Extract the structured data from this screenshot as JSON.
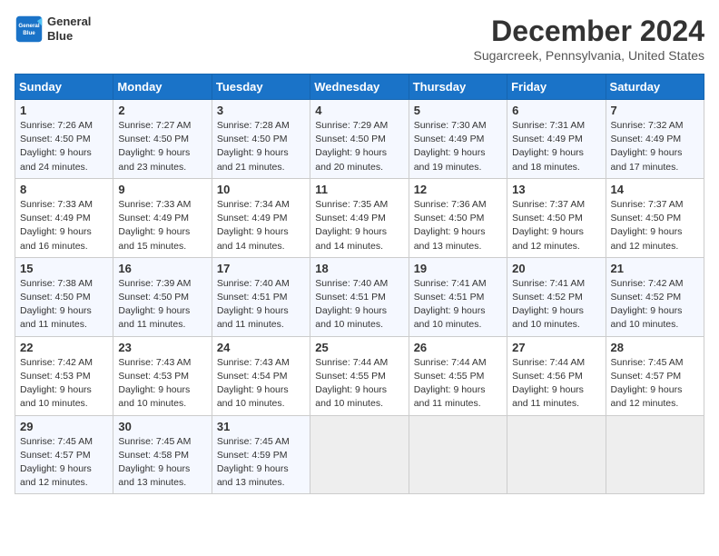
{
  "header": {
    "logo_line1": "General",
    "logo_line2": "Blue",
    "month": "December 2024",
    "location": "Sugarcreek, Pennsylvania, United States"
  },
  "days_of_week": [
    "Sunday",
    "Monday",
    "Tuesday",
    "Wednesday",
    "Thursday",
    "Friday",
    "Saturday"
  ],
  "weeks": [
    [
      {
        "day": "1",
        "info": "Sunrise: 7:26 AM\nSunset: 4:50 PM\nDaylight: 9 hours\nand 24 minutes."
      },
      {
        "day": "2",
        "info": "Sunrise: 7:27 AM\nSunset: 4:50 PM\nDaylight: 9 hours\nand 23 minutes."
      },
      {
        "day": "3",
        "info": "Sunrise: 7:28 AM\nSunset: 4:50 PM\nDaylight: 9 hours\nand 21 minutes."
      },
      {
        "day": "4",
        "info": "Sunrise: 7:29 AM\nSunset: 4:50 PM\nDaylight: 9 hours\nand 20 minutes."
      },
      {
        "day": "5",
        "info": "Sunrise: 7:30 AM\nSunset: 4:49 PM\nDaylight: 9 hours\nand 19 minutes."
      },
      {
        "day": "6",
        "info": "Sunrise: 7:31 AM\nSunset: 4:49 PM\nDaylight: 9 hours\nand 18 minutes."
      },
      {
        "day": "7",
        "info": "Sunrise: 7:32 AM\nSunset: 4:49 PM\nDaylight: 9 hours\nand 17 minutes."
      }
    ],
    [
      {
        "day": "8",
        "info": "Sunrise: 7:33 AM\nSunset: 4:49 PM\nDaylight: 9 hours\nand 16 minutes."
      },
      {
        "day": "9",
        "info": "Sunrise: 7:33 AM\nSunset: 4:49 PM\nDaylight: 9 hours\nand 15 minutes."
      },
      {
        "day": "10",
        "info": "Sunrise: 7:34 AM\nSunset: 4:49 PM\nDaylight: 9 hours\nand 14 minutes."
      },
      {
        "day": "11",
        "info": "Sunrise: 7:35 AM\nSunset: 4:49 PM\nDaylight: 9 hours\nand 14 minutes."
      },
      {
        "day": "12",
        "info": "Sunrise: 7:36 AM\nSunset: 4:50 PM\nDaylight: 9 hours\nand 13 minutes."
      },
      {
        "day": "13",
        "info": "Sunrise: 7:37 AM\nSunset: 4:50 PM\nDaylight: 9 hours\nand 12 minutes."
      },
      {
        "day": "14",
        "info": "Sunrise: 7:37 AM\nSunset: 4:50 PM\nDaylight: 9 hours\nand 12 minutes."
      }
    ],
    [
      {
        "day": "15",
        "info": "Sunrise: 7:38 AM\nSunset: 4:50 PM\nDaylight: 9 hours\nand 11 minutes."
      },
      {
        "day": "16",
        "info": "Sunrise: 7:39 AM\nSunset: 4:50 PM\nDaylight: 9 hours\nand 11 minutes."
      },
      {
        "day": "17",
        "info": "Sunrise: 7:40 AM\nSunset: 4:51 PM\nDaylight: 9 hours\nand 11 minutes."
      },
      {
        "day": "18",
        "info": "Sunrise: 7:40 AM\nSunset: 4:51 PM\nDaylight: 9 hours\nand 10 minutes."
      },
      {
        "day": "19",
        "info": "Sunrise: 7:41 AM\nSunset: 4:51 PM\nDaylight: 9 hours\nand 10 minutes."
      },
      {
        "day": "20",
        "info": "Sunrise: 7:41 AM\nSunset: 4:52 PM\nDaylight: 9 hours\nand 10 minutes."
      },
      {
        "day": "21",
        "info": "Sunrise: 7:42 AM\nSunset: 4:52 PM\nDaylight: 9 hours\nand 10 minutes."
      }
    ],
    [
      {
        "day": "22",
        "info": "Sunrise: 7:42 AM\nSunset: 4:53 PM\nDaylight: 9 hours\nand 10 minutes."
      },
      {
        "day": "23",
        "info": "Sunrise: 7:43 AM\nSunset: 4:53 PM\nDaylight: 9 hours\nand 10 minutes."
      },
      {
        "day": "24",
        "info": "Sunrise: 7:43 AM\nSunset: 4:54 PM\nDaylight: 9 hours\nand 10 minutes."
      },
      {
        "day": "25",
        "info": "Sunrise: 7:44 AM\nSunset: 4:55 PM\nDaylight: 9 hours\nand 10 minutes."
      },
      {
        "day": "26",
        "info": "Sunrise: 7:44 AM\nSunset: 4:55 PM\nDaylight: 9 hours\nand 11 minutes."
      },
      {
        "day": "27",
        "info": "Sunrise: 7:44 AM\nSunset: 4:56 PM\nDaylight: 9 hours\nand 11 minutes."
      },
      {
        "day": "28",
        "info": "Sunrise: 7:45 AM\nSunset: 4:57 PM\nDaylight: 9 hours\nand 12 minutes."
      }
    ],
    [
      {
        "day": "29",
        "info": "Sunrise: 7:45 AM\nSunset: 4:57 PM\nDaylight: 9 hours\nand 12 minutes."
      },
      {
        "day": "30",
        "info": "Sunrise: 7:45 AM\nSunset: 4:58 PM\nDaylight: 9 hours\nand 13 minutes."
      },
      {
        "day": "31",
        "info": "Sunrise: 7:45 AM\nSunset: 4:59 PM\nDaylight: 9 hours\nand 13 minutes."
      },
      {
        "day": "",
        "info": ""
      },
      {
        "day": "",
        "info": ""
      },
      {
        "day": "",
        "info": ""
      },
      {
        "day": "",
        "info": ""
      }
    ]
  ]
}
